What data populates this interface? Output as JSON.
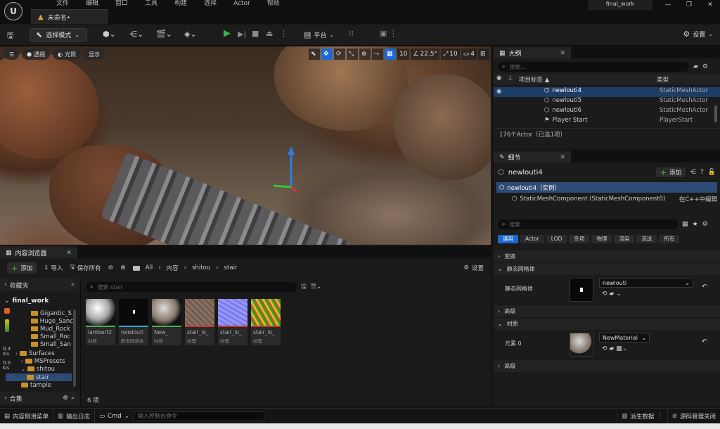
{
  "menu": [
    "文件",
    "编辑",
    "窗口",
    "工具",
    "构建",
    "选择",
    "Actor",
    "帮助"
  ],
  "doc_tab": "未命名•",
  "project_name": "final_work",
  "toolbar": {
    "mode": "选择模式",
    "platform": "平台",
    "settings": "设置"
  },
  "viewport": {
    "perspective": "透视",
    "lit": "光照",
    "show": "显示",
    "grid": "10",
    "angle": "22.5°",
    "scale": "10",
    "cam": "4"
  },
  "outline": {
    "tab": "大纲",
    "search_placeholder": "搜索...",
    "col_label": "项目标签 ▲",
    "col_type": "类型",
    "rows": [
      {
        "name": "newlouti4",
        "type": "StaticMeshActor",
        "selected": true
      },
      {
        "name": "newlouti5",
        "type": "StaticMeshActor"
      },
      {
        "name": "newlouti6",
        "type": "StaticMeshActor"
      },
      {
        "name": "Player Start",
        "type": "PlayerStart"
      }
    ],
    "count": "176个Actor（已选1项）"
  },
  "details": {
    "tab": "细节",
    "actor": "newlouti4",
    "add": "添加",
    "instance": "newlouti4（实例）",
    "component": "StaticMeshComponent (StaticMeshComponent0)",
    "edit_cpp": "在C++中编辑",
    "search_placeholder": "搜索",
    "categories": [
      "通用",
      "Actor",
      "LOD",
      "杂项",
      "物理",
      "渲染",
      "流送",
      "所有"
    ],
    "sec_transform": "变换",
    "sec_mesh": "静态网格体",
    "mesh_label": "静态网格体",
    "mesh_value": "newlouti",
    "sec_advanced": "高级",
    "sec_material": "材质",
    "elem_label": "元素 0",
    "material_value": "NewMaterial",
    "sec_advanced2": "高级"
  },
  "content_browser": {
    "tab": "内容浏览器",
    "add": "添加",
    "import": "导入",
    "save_all": "保存所有",
    "path": [
      "All",
      "内容",
      "shitou",
      "stair"
    ],
    "settings": "设置",
    "favorites": "收藏夹",
    "root": "final_work",
    "tree": [
      "Gigantic_S",
      "Huge_Sanc",
      "Mud_Rock",
      "Small_Roc",
      "Small_San",
      "Surfaces",
      "MSPresets",
      "shitou",
      "stair",
      "tample"
    ],
    "collections": "合集",
    "search_placeholder": "搜索 stair",
    "stat1": "0.3",
    "stat1u": "K/s",
    "stat2": "0.0",
    "stat2u": "K/s",
    "assets": [
      {
        "name": "lambert2",
        "type": "材质",
        "color": "#4caf50"
      },
      {
        "name": "newlouti",
        "type": "静态网格体",
        "color": "#2fa6d8"
      },
      {
        "name": "New_",
        "type": "材质",
        "color": "#4caf50"
      },
      {
        "name": "stair_lo_",
        "type": "纹理",
        "color": "#c0392b"
      },
      {
        "name": "stair_lo_",
        "type": "纹理",
        "color": "#c0392b"
      },
      {
        "name": "stair_lo_",
        "type": "纹理",
        "color": "#c0392b"
      }
    ],
    "count": "6 项"
  },
  "statusbar": {
    "drawer": "内容侧滑菜单",
    "log": "输出日志",
    "cmd": "Cmd",
    "console_placeholder": "输入控制台命令",
    "derived": "派生数据",
    "source": "源码管理关闭"
  }
}
